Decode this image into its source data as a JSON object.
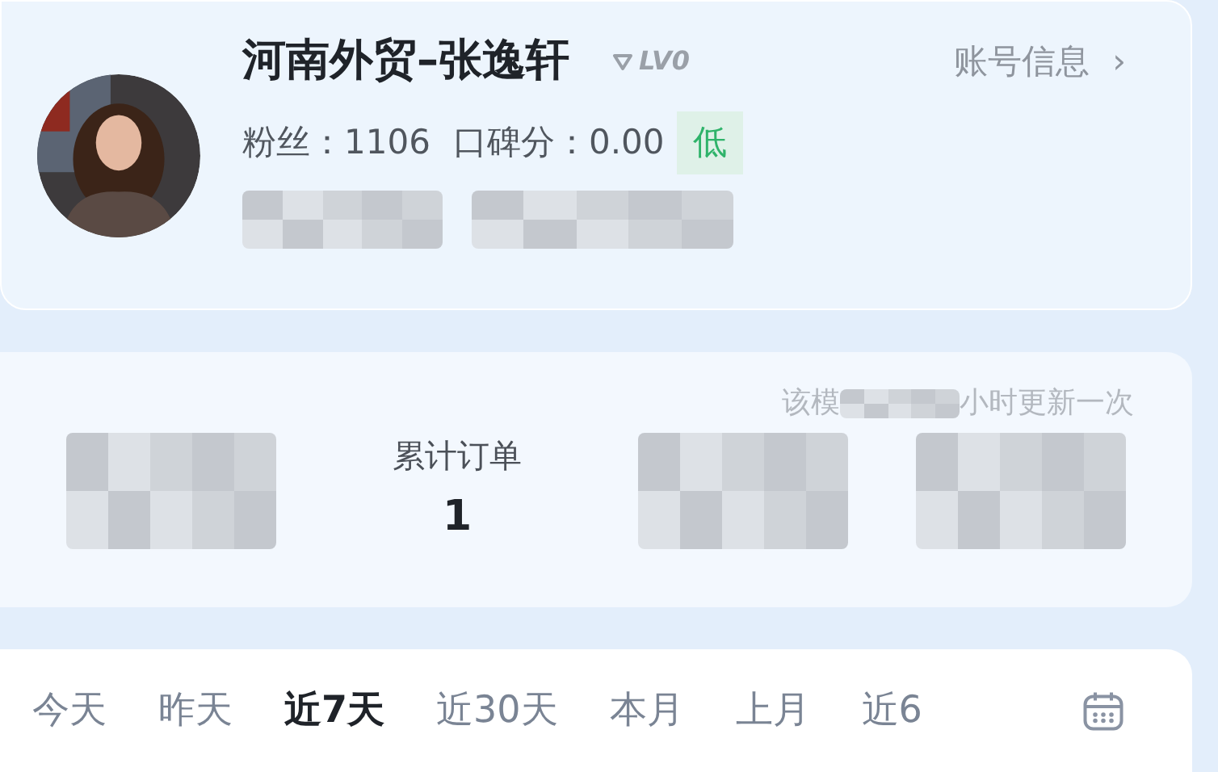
{
  "profile": {
    "name": "河南外贸–张逸轩",
    "level": "LV0",
    "account_link": "账号信息",
    "chevron": "›",
    "fans_label": "粉丝：",
    "fans": "1106",
    "score_label": "口碑分：",
    "score": "0.00",
    "rating": "低"
  },
  "stats_card": {
    "note_start": "该模",
    "note_end": "小时更新一次",
    "stats": [
      {
        "kind": "redacted"
      },
      {
        "kind": "stat",
        "label": "累计订单",
        "value": "1"
      },
      {
        "kind": "redacted"
      },
      {
        "kind": "redacted"
      }
    ]
  },
  "date_tabs": [
    {
      "label": "今天",
      "selected": false
    },
    {
      "label": "昨天",
      "selected": false
    },
    {
      "label": "近7天",
      "selected": true
    },
    {
      "label": "近30天",
      "selected": false
    },
    {
      "label": "本月",
      "selected": false
    },
    {
      "label": "上月",
      "selected": false
    },
    {
      "label": "近6",
      "selected": false
    }
  ]
}
